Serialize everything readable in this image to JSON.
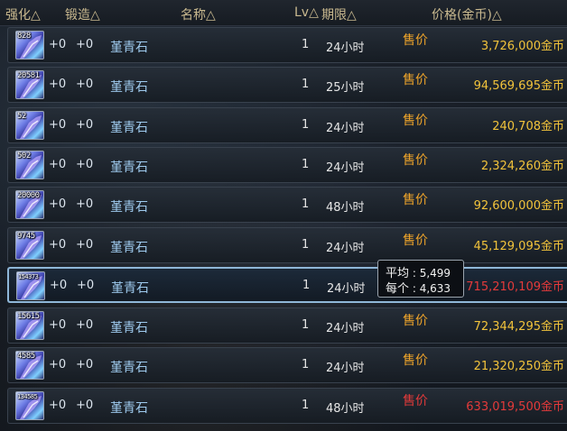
{
  "headers": {
    "enhance": "强化△",
    "forge": "锻造△",
    "name": "名称△",
    "level": "Lv△",
    "duration": "期限△",
    "price": "价格(金币)△"
  },
  "rows": [
    {
      "count": "828",
      "enhance": "+0",
      "forge": "+0",
      "name": "堇青石",
      "level": "1",
      "duration": "24小时",
      "sale": "售价",
      "price": "3,726,000金币",
      "price_red": false
    },
    {
      "count": "20581",
      "enhance": "+0",
      "forge": "+0",
      "name": "堇青石",
      "level": "1",
      "duration": "25小时",
      "sale": "售价",
      "price": "94,569,695金币",
      "price_red": false
    },
    {
      "count": "52",
      "enhance": "+0",
      "forge": "+0",
      "name": "堇青石",
      "level": "1",
      "duration": "24小时",
      "sale": "售价",
      "price": "240,708金币",
      "price_red": false
    },
    {
      "count": "502",
      "enhance": "+0",
      "forge": "+0",
      "name": "堇青石",
      "level": "1",
      "duration": "24小时",
      "sale": "售价",
      "price": "2,324,260金币",
      "price_red": false
    },
    {
      "count": "20000",
      "enhance": "+0",
      "forge": "+0",
      "name": "堇青石",
      "level": "1",
      "duration": "48小时",
      "sale": "售价",
      "price": "92,600,000金币",
      "price_red": false
    },
    {
      "count": "9745",
      "enhance": "+0",
      "forge": "+0",
      "name": "堇青石",
      "level": "1",
      "duration": "24小时",
      "sale": "售价",
      "price": "45,129,095金币",
      "price_red": false
    },
    {
      "count": "154373",
      "enhance": "+0",
      "forge": "+0",
      "name": "堇青石",
      "level": "1",
      "duration": "24小时",
      "sale": "",
      "price": "715,210,109金币",
      "price_red": true
    },
    {
      "count": "15615",
      "enhance": "+0",
      "forge": "+0",
      "name": "堇青石",
      "level": "1",
      "duration": "24小时",
      "sale": "售价",
      "price": "72,344,295金币",
      "price_red": false
    },
    {
      "count": "4585",
      "enhance": "+0",
      "forge": "+0",
      "name": "堇青石",
      "level": "1",
      "duration": "24小时",
      "sale": "售价",
      "price": "21,320,250金币",
      "price_red": false
    },
    {
      "count": "134585",
      "enhance": "+0",
      "forge": "+0",
      "name": "堇青石",
      "level": "1",
      "duration": "48小时",
      "sale": "售价",
      "price": "633,019,500金币",
      "price_red": true
    }
  ],
  "tooltip": {
    "avg_label": "平均",
    "avg_value": ": 5,499",
    "each_label": "每个",
    "each_value": ": 4,633"
  },
  "colors": {
    "header_text": "#c9b98f",
    "name_text": "#9fcbef",
    "sale_label": "#f0a52a",
    "price_text": "#f2c33b",
    "price_high": "#e43a3a",
    "selected_border": "#8fb7d8"
  },
  "selected_row": 6
}
